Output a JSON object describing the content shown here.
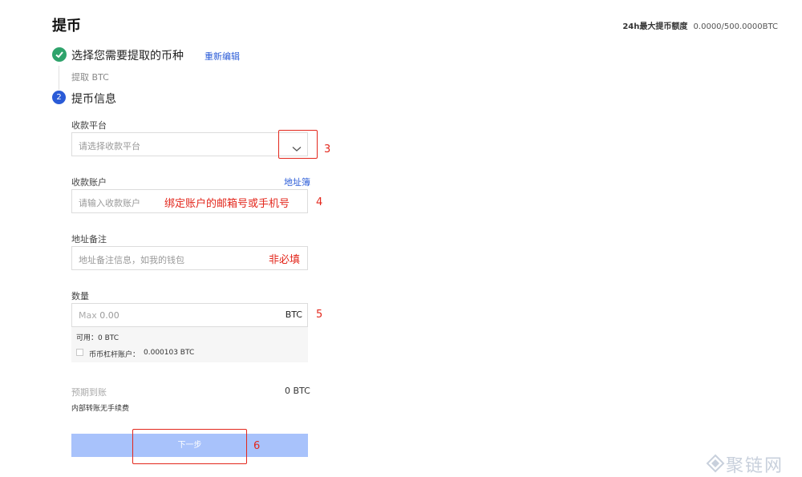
{
  "page": {
    "title": "提币",
    "limit_label": "24h最大提币额度",
    "limit_value": "0.0000/500.0000BTC"
  },
  "step1": {
    "label": "选择您需要提取的币种",
    "edit_link": "重新编辑",
    "selected": "提取 BTC"
  },
  "step2": {
    "number": "2",
    "label": "提币信息"
  },
  "platform": {
    "label": "收款平台",
    "placeholder": "请选择收款平台"
  },
  "account": {
    "label": "收款账户",
    "address_book": "地址簿",
    "placeholder": "请输入收款账户",
    "note": "绑定账户的邮箱号或手机号"
  },
  "remark": {
    "label": "地址备注",
    "placeholder": "地址备注信息，如我的钱包",
    "note": "非必填"
  },
  "amount": {
    "label": "数量",
    "placeholder_max": "Max",
    "placeholder_value": "0.00",
    "unit": "BTC",
    "available": "可用：0 BTC",
    "leverage_label": "币币杠杆账户：",
    "leverage_value": "0.000103 BTC"
  },
  "expected": {
    "label": "预期到账",
    "value": "0 BTC",
    "fee_note": "内部转账无手续费"
  },
  "next_button": "下一步",
  "annotations": [
    "3",
    "4",
    "5",
    "6"
  ],
  "watermark": "聚链网",
  "colors": {
    "primary": "#2a5bd7",
    "success": "#2ea36b",
    "annotation": "#e3271c",
    "button_disabled": "#a8c2fb"
  }
}
